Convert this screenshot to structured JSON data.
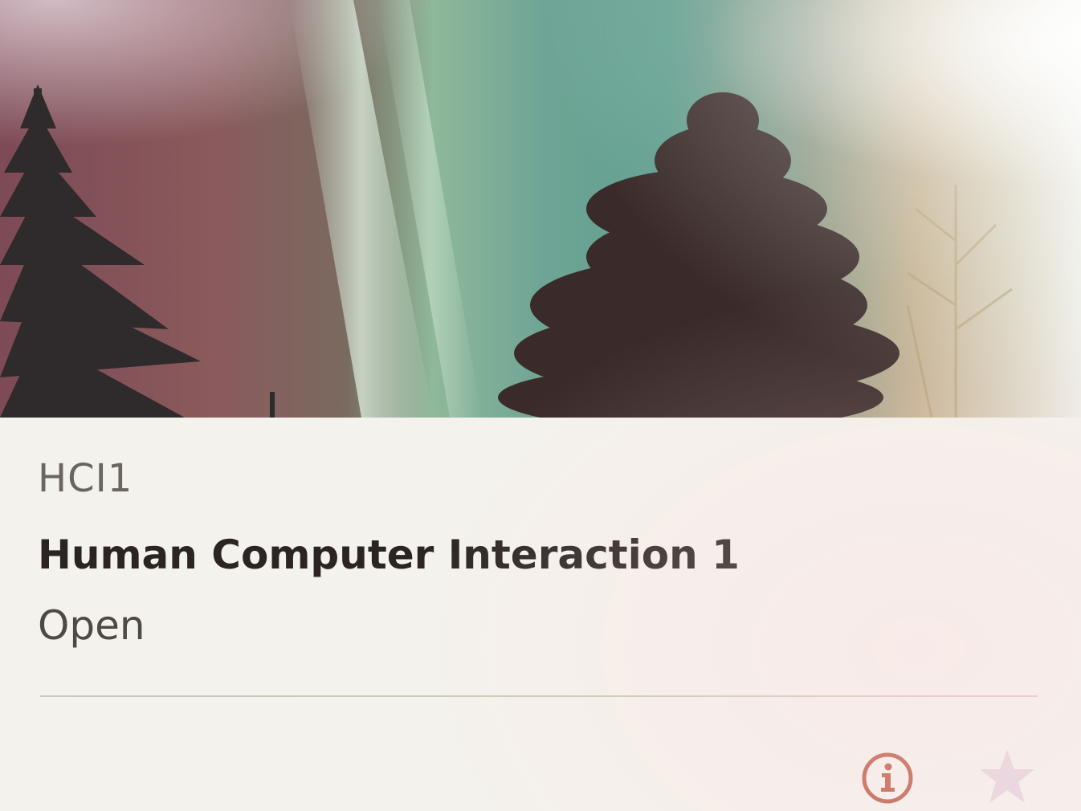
{
  "card": {
    "code": "HCI1",
    "title": "Human Computer Interaction 1",
    "status": "Open"
  },
  "icons": {
    "info": "info-icon",
    "favorite": "star-icon"
  },
  "colors": {
    "info_icon": "#c0624e",
    "star_icon": "#e6d6de",
    "title_text": "#2a2522",
    "code_text": "#6a6560"
  }
}
